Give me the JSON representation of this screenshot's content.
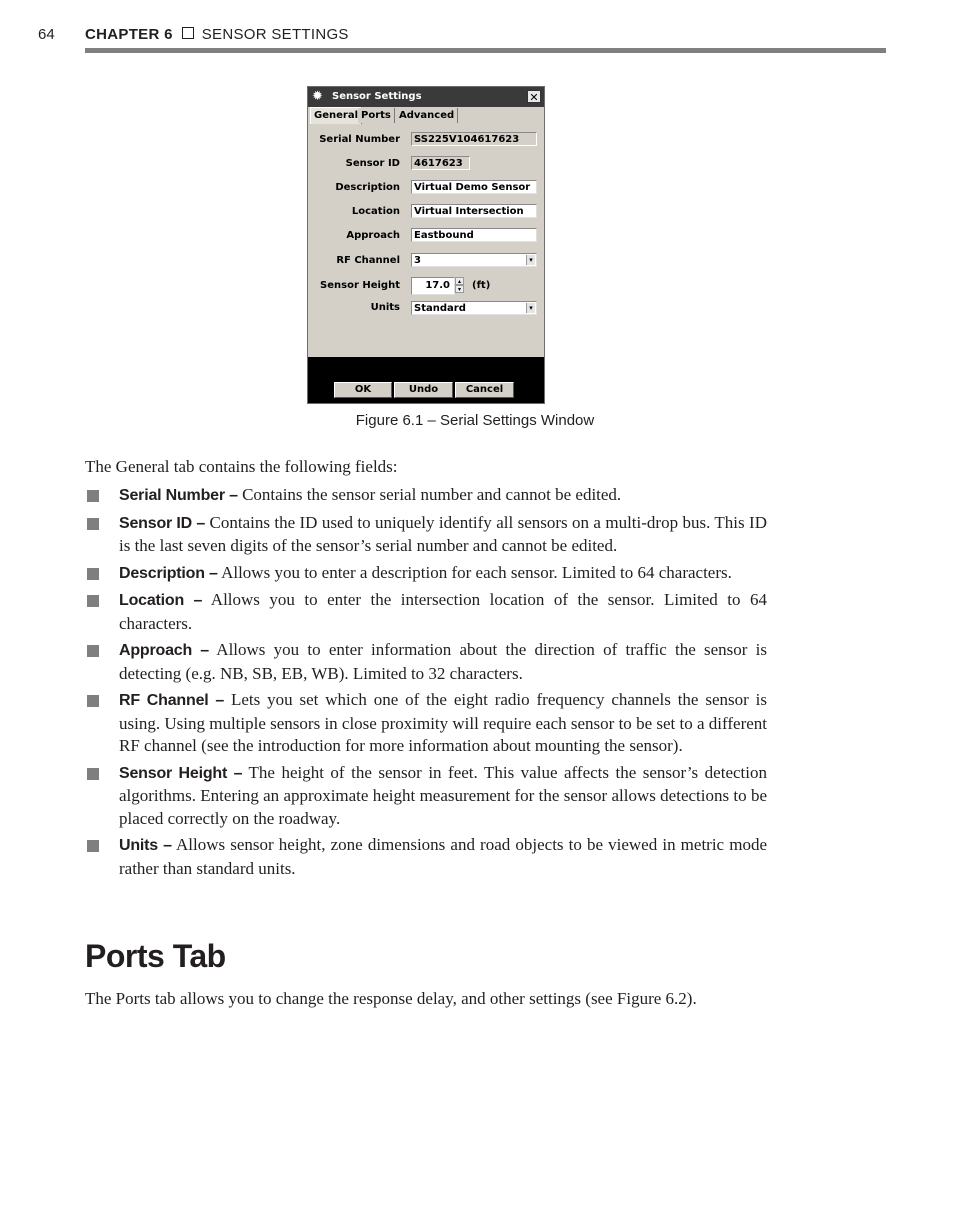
{
  "header": {
    "page_number": "64",
    "chapter_label": "CHAPTER 6",
    "chapter_title": "SENSOR SETTINGS"
  },
  "dialog": {
    "title": "Sensor Settings",
    "close_glyph": "✕",
    "gear_glyph": "✹",
    "tabs": [
      {
        "label": "General",
        "active": true
      },
      {
        "label": "Ports",
        "active": false
      },
      {
        "label": "Advanced",
        "active": false
      }
    ],
    "fields": {
      "serial_number": {
        "label": "Serial Number",
        "value": "SS225V104617623"
      },
      "sensor_id": {
        "label": "Sensor ID",
        "value": "4617623"
      },
      "description": {
        "label": "Description",
        "value": "Virtual Demo Sensor"
      },
      "location": {
        "label": "Location",
        "value": "Virtual Intersection"
      },
      "approach": {
        "label": "Approach",
        "value": "Eastbound"
      },
      "rf_channel": {
        "label": "RF Channel",
        "value": "3"
      },
      "sensor_height": {
        "label": "Sensor Height",
        "value": "17.0",
        "unit": "(ft)"
      },
      "units": {
        "label": "Units",
        "value": "Standard"
      }
    },
    "buttons": {
      "ok": "OK",
      "undo": "Undo",
      "cancel": "Cancel"
    }
  },
  "figure_caption": "Figure 6.1 – Serial Settings Window",
  "intro_text": "The General tab contains the following fields:",
  "bullets": [
    {
      "term": "Serial Number –",
      "text": " Contains the sensor serial number and cannot be edited."
    },
    {
      "term": "Sensor ID –",
      "text": " Contains the ID used to uniquely identify all sensors on a multi-drop bus. This ID is the last seven digits of the sensor’s serial number and cannot be edited."
    },
    {
      "term": "Description –",
      "text": " Allows you to enter a description for each sensor. Limited to 64 characters."
    },
    {
      "term": "Location –",
      "text": " Allows you to enter the intersection location of the sensor. Limited to 64 characters."
    },
    {
      "term": "Approach –",
      "text": " Allows you to enter information about the direction of traffic the sensor is detecting (e.g. NB, SB, EB, WB). Limited to 32 characters."
    },
    {
      "term": "RF Channel –",
      "text": " Lets you set which one of the eight radio frequency channels the sensor is using. Using multiple sensors in close proximity will require each sensor to be set to a different RF channel (see the introduction for more information about mounting the sensor)."
    },
    {
      "term": "Sensor Height –",
      "text": " The height of the sensor in feet. This value affects the sensor’s detection algorithms. Entering an approximate height measurement for the sensor allows detections to be placed correctly on the roadway."
    },
    {
      "term": "Units –",
      "text": " Allows sensor height, zone dimensions and road objects to be viewed in metric mode rather than standard units."
    }
  ],
  "section": {
    "title": "Ports Tab",
    "body": "The Ports tab allows you to change the response delay, and other settings (see Figure 6.2)."
  }
}
